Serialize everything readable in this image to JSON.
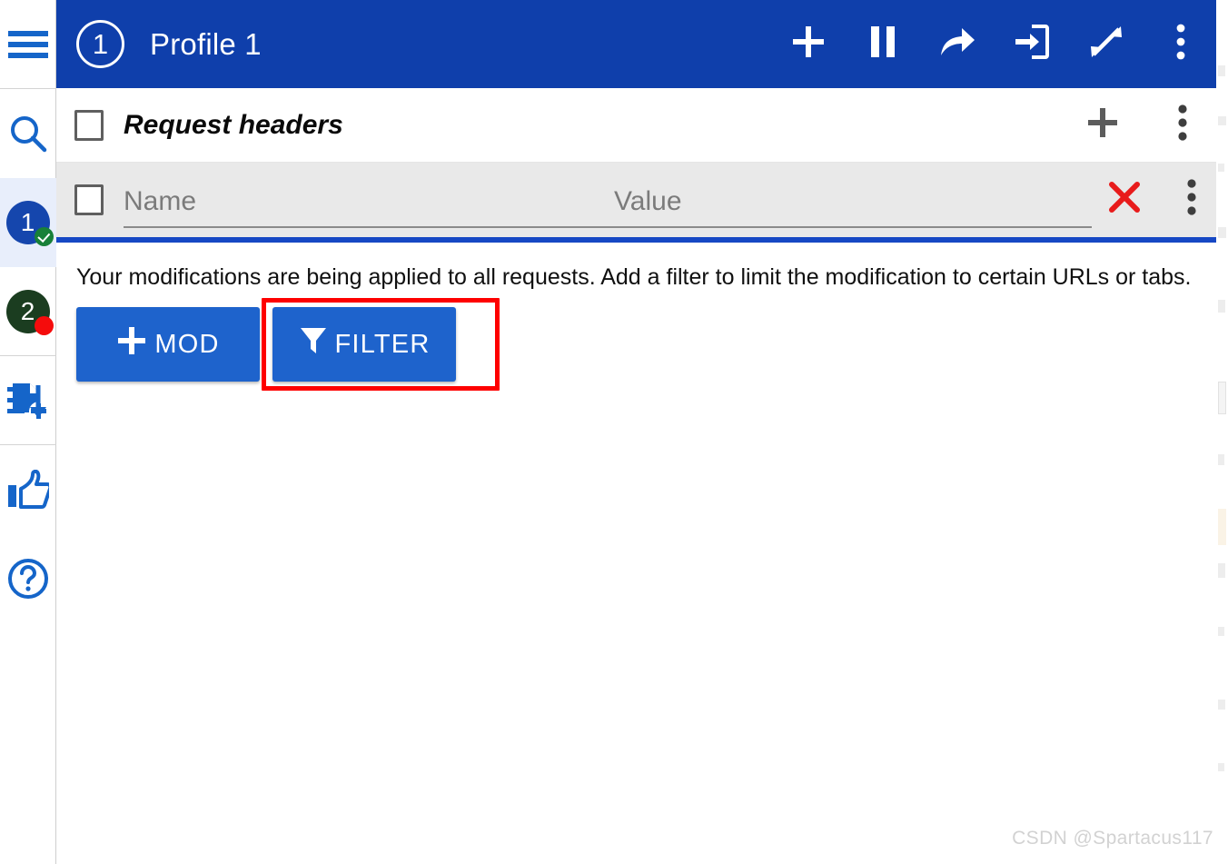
{
  "sidebar": {
    "items": [
      {
        "name": "menu",
        "icon": "hamburger-menu-icon",
        "label": "Menu"
      },
      {
        "name": "search",
        "icon": "search-icon",
        "label": "Search"
      },
      {
        "name": "profile-1",
        "icon": "profile-badge-icon",
        "label": "1",
        "badge": "check",
        "active": true
      },
      {
        "name": "profile-2",
        "icon": "profile-badge-icon",
        "label": "2",
        "badge": "dot",
        "active": false
      },
      {
        "name": "new-profile",
        "icon": "document-plus-icon",
        "label": "New profile"
      },
      {
        "name": "sort",
        "icon": "sort-descending-icon",
        "label": "Sort"
      },
      {
        "name": "rate",
        "icon": "thumbs-up-icon",
        "label": "Rate"
      },
      {
        "name": "help",
        "icon": "help-circle-icon",
        "label": "Help"
      }
    ]
  },
  "appbar": {
    "profile_number": "1",
    "title": "Profile 1",
    "actions": [
      {
        "name": "add",
        "icon": "plus-icon"
      },
      {
        "name": "pause",
        "icon": "pause-icon"
      },
      {
        "name": "share",
        "icon": "share-arrow-icon"
      },
      {
        "name": "import",
        "icon": "import-icon"
      },
      {
        "name": "expand",
        "icon": "expand-diagonal-icon"
      },
      {
        "name": "more",
        "icon": "more-vertical-icon"
      }
    ]
  },
  "section": {
    "title": "Request headers",
    "checkbox_checked": false,
    "add_label": "Add",
    "more_label": "More options"
  },
  "header_row": {
    "checkbox_checked": false,
    "name_placeholder": "Name",
    "name_value": "",
    "value_placeholder": "Value",
    "value_value": "",
    "delete_label": "Delete",
    "more_label": "More options"
  },
  "body": {
    "hint": "Your modifications are being applied to all requests. Add a filter to limit the modification to certain URLs or tabs.",
    "buttons": [
      {
        "name": "add-mod-button",
        "label": "MOD",
        "icon": "plus-icon",
        "highlighted": false
      },
      {
        "name": "add-filter-button",
        "label": "FILTER",
        "icon": "funnel-icon",
        "highlighted": true
      }
    ]
  },
  "annotation": {
    "highlight_color": "#fe0000",
    "target": "add-filter-button"
  },
  "colors": {
    "appbar_blue": "#0f3fab",
    "button_blue": "#1e63cc",
    "icon_blue": "#1565c9",
    "rule_blue": "#1648c4",
    "row_gray": "#e9e9e9",
    "delete_red": "#e81b1b",
    "badge_green": "#188038",
    "badge_dark_green": "#1b3d20",
    "badge_red": "#f50c0c"
  },
  "watermark": {
    "text": "CSDN @Spartacus117"
  }
}
